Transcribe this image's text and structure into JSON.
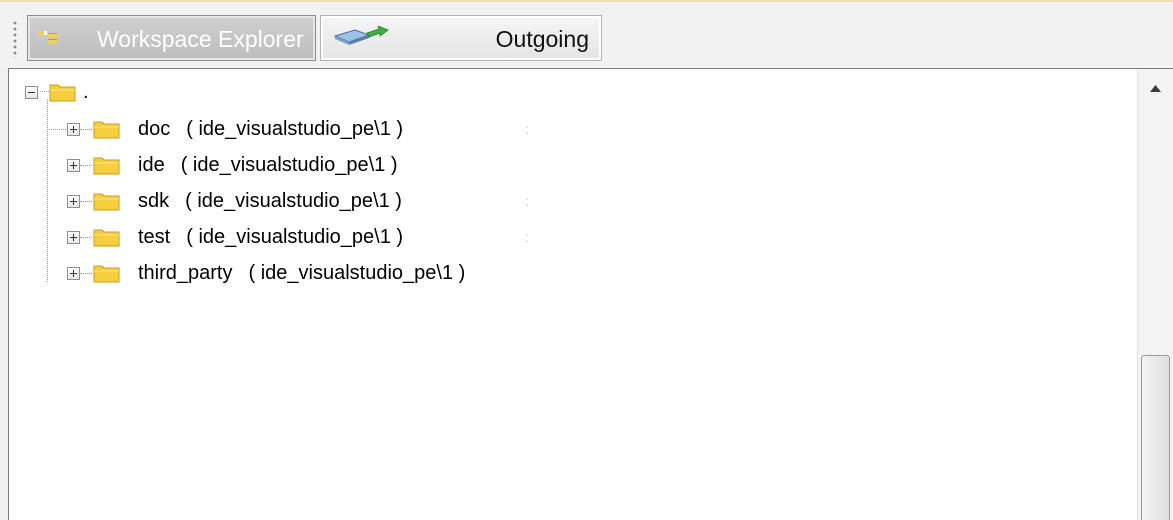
{
  "tabs": [
    {
      "label": "Workspace Explorer",
      "icon": "workspace-explorer-icon",
      "active": true
    },
    {
      "label": "Outgoing",
      "icon": "outgoing-changes-icon",
      "active": false
    }
  ],
  "tree": {
    "root": {
      "label": ".",
      "expanded": true
    },
    "children": [
      {
        "name": "doc",
        "workspace": "( ide_visualstudio_pe\\1 )"
      },
      {
        "name": "ide",
        "workspace": "( ide_visualstudio_pe\\1 )"
      },
      {
        "name": "sdk",
        "workspace": "( ide_visualstudio_pe\\1 )"
      },
      {
        "name": "test",
        "workspace": "( ide_visualstudio_pe\\1 )"
      },
      {
        "name": "third_party",
        "workspace": "( ide_visualstudio_pe\\1 )"
      }
    ]
  },
  "colors": {
    "folder": "#f7cf3c",
    "folder_dark": "#d6a81a",
    "active_tab": "#c6c6c6",
    "accent_border": "#f0e2b6"
  }
}
